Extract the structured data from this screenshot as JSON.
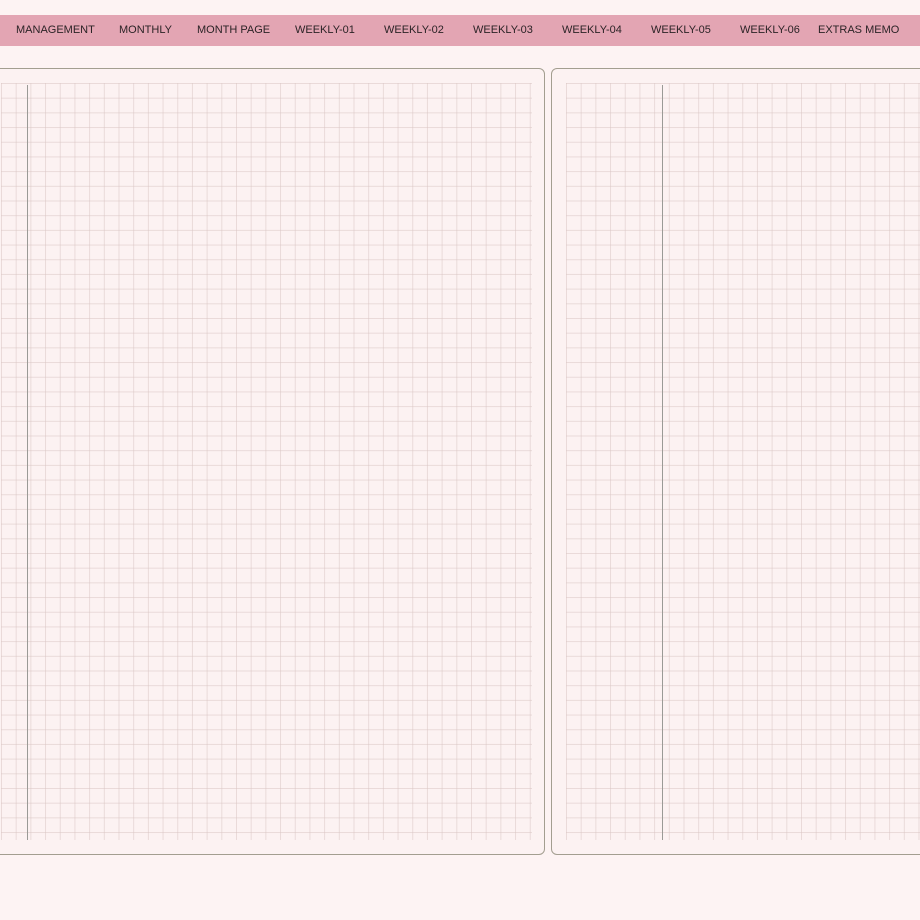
{
  "nav": {
    "tabs": [
      {
        "label": "MANAGEMENT"
      },
      {
        "label": "MONTHLY"
      },
      {
        "label": "MONTH PAGE"
      },
      {
        "label": "WEEKLY-01"
      },
      {
        "label": "WEEKLY-02"
      },
      {
        "label": "WEEKLY-03"
      },
      {
        "label": "WEEKLY-04"
      },
      {
        "label": "WEEKLY-05"
      },
      {
        "label": "WEEKLY-06"
      },
      {
        "label": "EXTRAS MEMO"
      }
    ]
  },
  "colors": {
    "nav_background": "#e3a5b3",
    "page_background": "#fcf2f2",
    "app_background": "#fdf3f3",
    "page_border": "#a39e90",
    "grid_line": "#dac6c4",
    "margin_line": "#9a9a96"
  }
}
